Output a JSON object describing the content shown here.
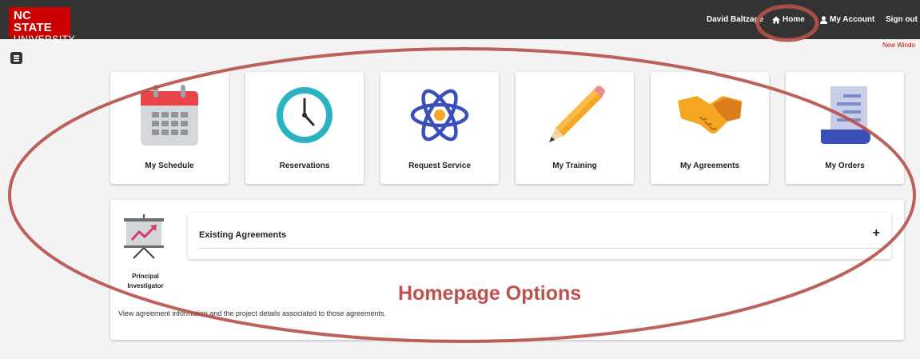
{
  "header": {
    "logo_line1": "NC STATE",
    "logo_line2": "UNIVERSITY",
    "user_name": "David Baltzage",
    "home_label": "Home",
    "account_label": "My Account",
    "signout_label": "Sign out",
    "new_window_label": "New Windo",
    "brand_color": "#cc0000"
  },
  "menu_toggle_icon": "menu-icon",
  "tiles": [
    {
      "label": "My Schedule",
      "icon": "calendar-icon"
    },
    {
      "label": "Reservations",
      "icon": "clock-icon"
    },
    {
      "label": "Request Service",
      "icon": "atom-icon"
    },
    {
      "label": "My Training",
      "icon": "pencil-icon"
    },
    {
      "label": "My Agreements",
      "icon": "handshake-icon"
    },
    {
      "label": "My Orders",
      "icon": "document-icon"
    }
  ],
  "panel": {
    "role_line1": "Principal",
    "role_line2": "Investigator",
    "accordion_title": "Existing Agreements",
    "expand_symbol": "+",
    "description": "View agreement information and the project details associated to those agreements."
  },
  "annotation": {
    "text": "Homepage Options",
    "color": "#c0504d"
  }
}
